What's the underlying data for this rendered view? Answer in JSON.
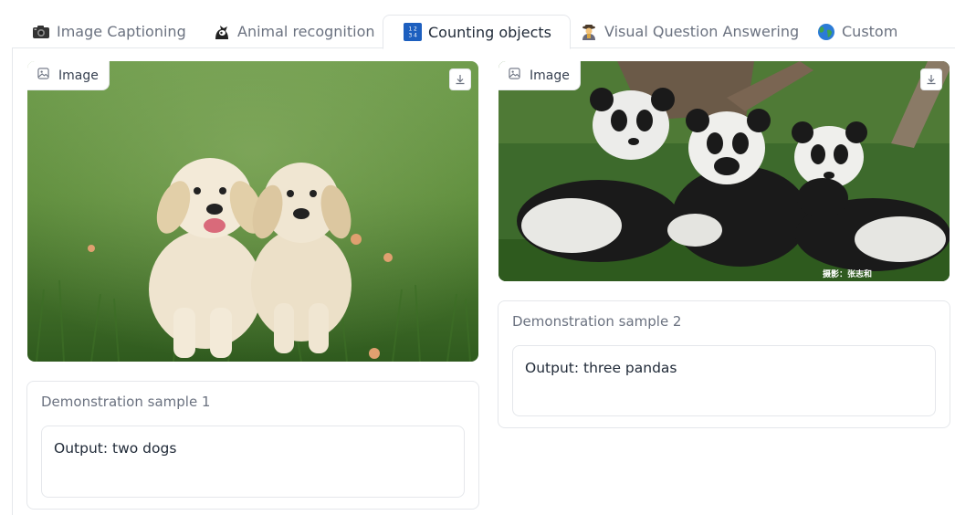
{
  "tabs": [
    {
      "label": "Image Captioning",
      "icon": "camera-icon"
    },
    {
      "label": "Animal recognition",
      "icon": "detective-icon"
    },
    {
      "label": "Counting objects",
      "icon": "numbers-1234-icon",
      "active": true
    },
    {
      "label": "Visual Question Answering",
      "icon": "detective-person-icon"
    },
    {
      "label": "Custom",
      "icon": "globe-icon"
    }
  ],
  "samples": [
    {
      "image_label": "Image",
      "title": "Demonstration sample 1",
      "output": "Output: two dogs"
    },
    {
      "image_label": "Image",
      "title": "Demonstration sample 2",
      "output": "Output: three pandas",
      "watermark": "摄影：张志和"
    }
  ],
  "colors": {
    "border": "#e5e7eb",
    "muted_text": "#6b7280",
    "text": "#1f2937",
    "accent_tab_icon": "#1d5fbf"
  }
}
